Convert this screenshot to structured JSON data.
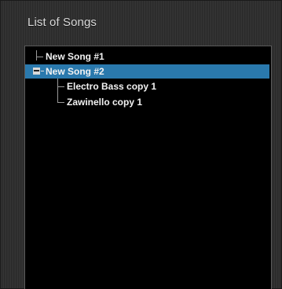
{
  "panel": {
    "title": "List of Songs"
  },
  "tree": {
    "items": [
      {
        "label": "New Song #1",
        "level": 0,
        "selected": false
      },
      {
        "label": "New Song #2",
        "level": 0,
        "selected": true,
        "expanded": true
      },
      {
        "label": "Electro Bass copy 1",
        "level": 1,
        "selected": false
      },
      {
        "label": "Zawinello copy 1",
        "level": 1,
        "selected": false
      }
    ]
  },
  "colors": {
    "selection": "#2a79ad",
    "tree_background": "#000000",
    "panel_background": "#2d2d2d"
  }
}
